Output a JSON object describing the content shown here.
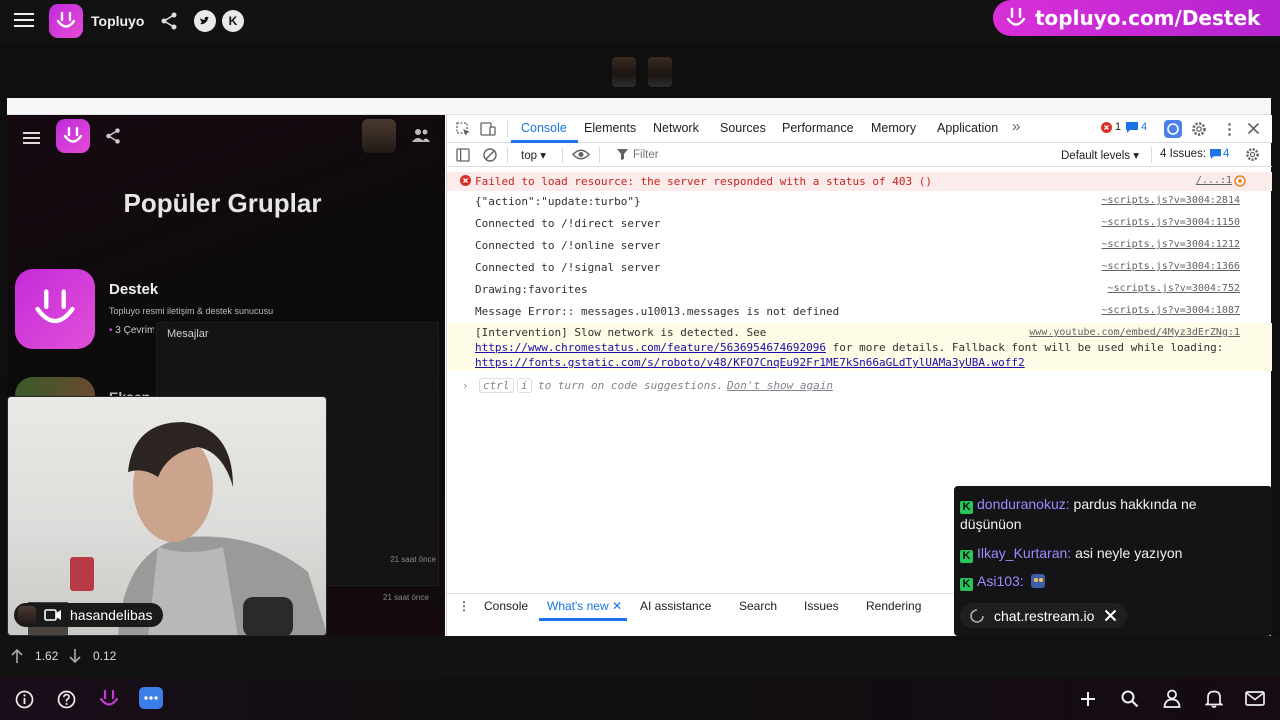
{
  "app": {
    "title": "Topluyo",
    "promo_text": "topluyo.com/Destek"
  },
  "site": {
    "page_title": "Popüler Gruplar",
    "group": {
      "name": "Destek",
      "description": "Topluyo resmi iletişim & destek sunucusu",
      "online": "3 Çevrimiçi"
    },
    "second_group_name": "Eksen",
    "tooltip_label": "Mesajlar",
    "timestamps": [
      "21 saat önce",
      "21 saat önce"
    ]
  },
  "devtools": {
    "tabs": [
      "Console",
      "Elements",
      "Network",
      "Sources",
      "Performance",
      "Memory",
      "Application"
    ],
    "active_tab": "Console",
    "error_count": "1",
    "message_count": "4",
    "context": "top",
    "filter_placeholder": "Filter",
    "levels": "Default levels",
    "issues_label": "4 Issues:",
    "issues_count": "4",
    "logs": [
      {
        "text": "Failed to load resource: the server responded with a status of 403 ()",
        "src": "/...:1",
        "type": "error"
      },
      {
        "text": "{\"action\":\"update:turbo\"}",
        "src": "~scripts.js?v=3004:2814",
        "type": "log"
      },
      {
        "text": "Connected to /!direct server",
        "src": "~scripts.js?v=3004:1150",
        "type": "log"
      },
      {
        "text": "Connected to /!online server",
        "src": "~scripts.js?v=3004:1212",
        "type": "log"
      },
      {
        "text": "Connected to /!signal server",
        "src": "~scripts.js?v=3004:1366",
        "type": "log"
      },
      {
        "text": "Drawing:favorites",
        "src": "~scripts.js?v=3004:752",
        "type": "log"
      },
      {
        "text": "Message Error:: messages.u10013.messages is not defined",
        "src": "~scripts.js?v=3004:1087",
        "type": "log"
      }
    ],
    "intervention": {
      "line1": "[Intervention] Slow network is detected. See",
      "link1": "https://www.chromestatus.com/feature/5636954674692096",
      "line2": "for more details. Fallback font will be used while loading:",
      "link2": "https://fonts.gstatic.com/s/roboto/v48/KFO7CnqEu92Fr1ME7kSn66aGLdTylUAMa3yUBA.woff2",
      "src": "www.youtube.com/embed/4Myz3dErZNg:1"
    },
    "hint": {
      "key1": "ctrl",
      "key2": "i",
      "text": "to turn on code suggestions.",
      "dismiss": "Don't show again"
    },
    "drawer_tabs": [
      "Console",
      "What's new",
      "AI assistance",
      "Search",
      "Issues",
      "Rendering"
    ],
    "drawer_active": "What's new"
  },
  "webcam": {
    "name": "hasandelibas"
  },
  "chat": {
    "messages": [
      {
        "user": "donduranokuz:",
        "text": "pardus hakkında ne düşünüon"
      },
      {
        "user": "Ilkay_Kurtaran:",
        "text": "asi neyle yazıyon"
      },
      {
        "user": "Asi103:",
        "text": ""
      }
    ],
    "source": "chat.restream.io"
  },
  "stats": {
    "up": "1.62",
    "down": "0.12"
  },
  "colors": {
    "brand": "#d22fd6",
    "chat_user": "#9b8cff",
    "kick_green": "#28c65a",
    "error_red": "#d93025"
  }
}
